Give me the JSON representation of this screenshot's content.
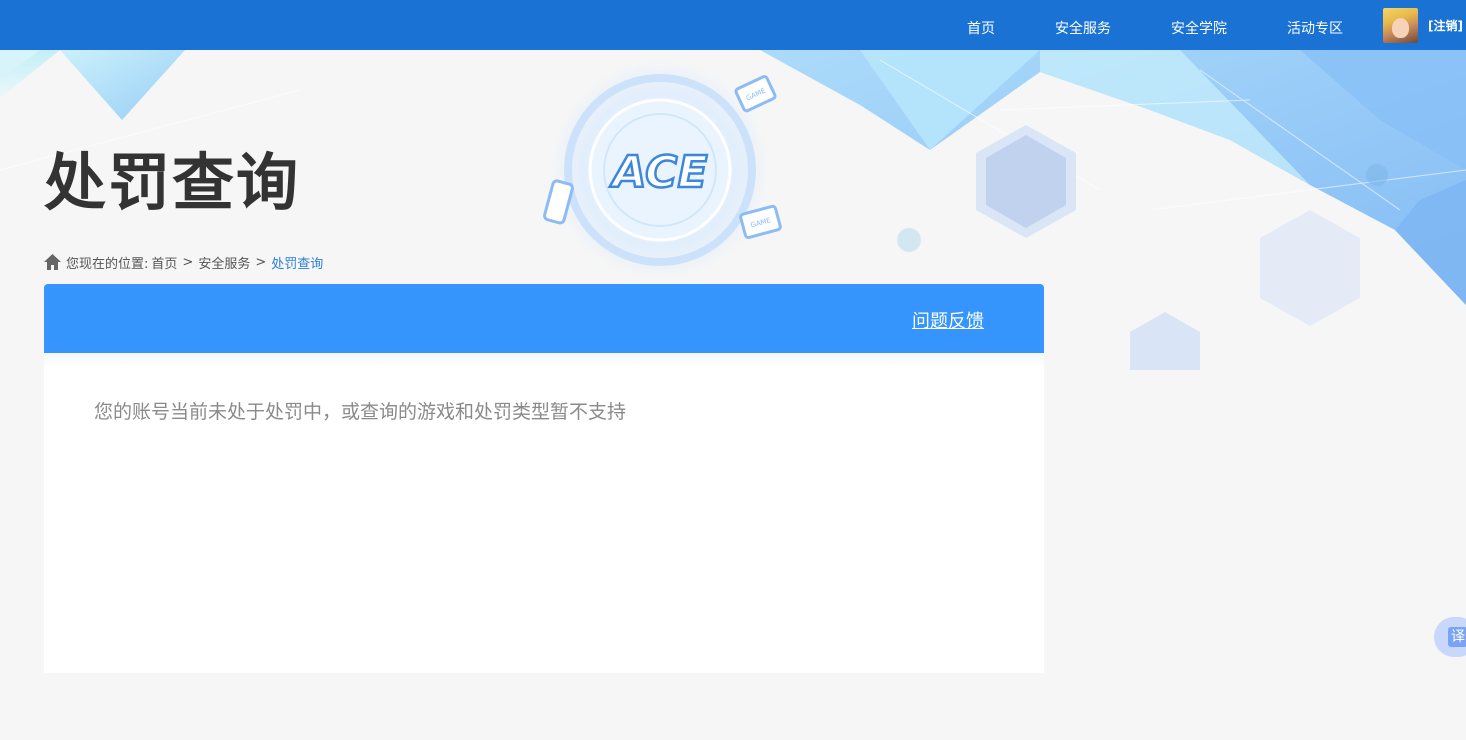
{
  "nav": {
    "items": [
      {
        "label": "首页"
      },
      {
        "label": "安全服务"
      },
      {
        "label": "安全学院"
      },
      {
        "label": "活动专区"
      }
    ],
    "logout_label": "[注销]"
  },
  "banner": {
    "logo_text": "ACE",
    "device_label": "GAME"
  },
  "page": {
    "title": "处罚查询"
  },
  "breadcrumb": {
    "prefix": "您现在的位置:",
    "items": [
      "首页",
      "安全服务"
    ],
    "separator": ">",
    "current": "处罚查询"
  },
  "card": {
    "feedback_label": "问题反馈",
    "message": "您的账号当前未处于处罚中，或查询的游戏和处罚类型暂不支持"
  },
  "widgets": {
    "translate_label": "译"
  },
  "colors": {
    "nav_bg": "#1a73d4",
    "card_header": "#3595fd",
    "breadcrumb_current": "#2a7ed8",
    "page_bg": "#f6f6f6"
  }
}
